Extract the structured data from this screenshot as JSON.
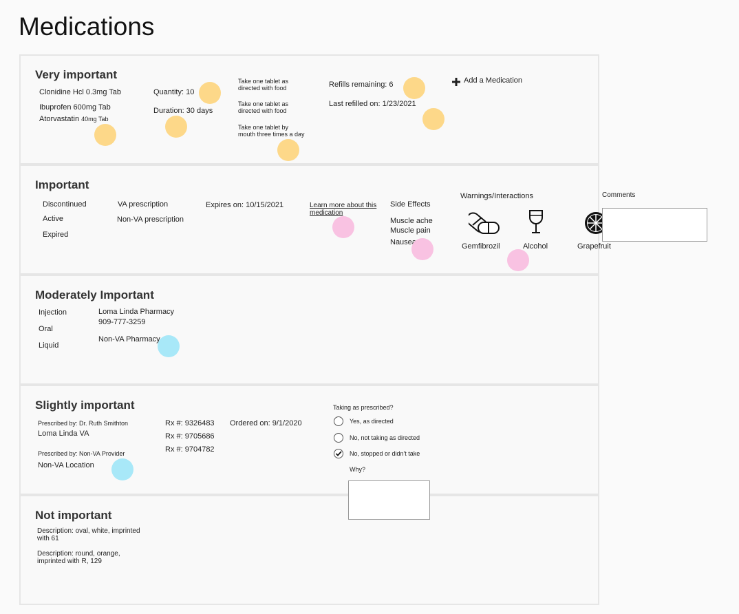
{
  "page": {
    "title": "Medications"
  },
  "colors": {
    "yellow_marker": "#fdd889",
    "pink_marker": "#f9c2e2",
    "blue_marker": "#a8e8f8"
  },
  "very_important": {
    "title": "Very important",
    "meds": [
      "Clonidine Hcl 0.3mg Tab",
      "Ibuprofen 600mg Tab",
      "Atorvastatin"
    ],
    "atorvastatin_dose": "40mg Tab",
    "quantity": "Quantity: 10",
    "duration": "Duration: 30 days",
    "instructions": [
      "Take one tablet as directed with food",
      "Take one tablet as directed with food",
      "Take one tablet by mouth three times a day"
    ],
    "refills": "Refills remaining: 6",
    "last_refilled": "Last refilled on: 1/23/2021",
    "add_medication": "Add a Medication"
  },
  "important": {
    "title": "Important",
    "statuses": [
      "Discontinued",
      "Active",
      "Expired"
    ],
    "prescription_types": [
      "VA prescription",
      "Non-VA prescription"
    ],
    "expires": "Expires on: 10/15/2021",
    "learn_more": "Learn more about this medication",
    "side_effects_label": "Side Effects",
    "side_effects": [
      "Muscle ache",
      "Muscle pain",
      "Nausea"
    ],
    "warnings_label": "Warnings/Interactions",
    "warnings": [
      "Gemfibrozil",
      "Alcohol",
      "Grapefruit"
    ],
    "comments_label": "Comments",
    "comments_value": ""
  },
  "moderately_important": {
    "title": "Moderately Important",
    "forms": [
      "Injection",
      "Oral",
      "Liquid"
    ],
    "pharmacy": "Loma Linda Pharmacy",
    "phone": "909-777-3259",
    "non_va_pharmacy": "Non-VA Pharmacy"
  },
  "slightly_important": {
    "title": "Slightly important",
    "prescribed_by_1": "Prescribed by: Dr. Ruth Smithton",
    "location_1": "Loma Linda VA",
    "prescribed_by_2": "Prescribed by: Non-VA Provider",
    "location_2": "Non-VA Location",
    "rx_numbers": [
      "Rx #: 9326483",
      "Rx #: 9705686",
      "Rx #: 9704782"
    ],
    "ordered_on": "Ordered on: 9/1/2020",
    "question": "Taking as prescribed?",
    "options": [
      "Yes, as directed",
      "No, not taking as directed",
      "No, stopped or didn't take"
    ],
    "why_label": "Why?",
    "why_value": ""
  },
  "not_important": {
    "title": "Not important",
    "descriptions": [
      "Description: oval, white, imprinted with 61",
      "Description: round, orange, imprinted with R, 129"
    ]
  }
}
